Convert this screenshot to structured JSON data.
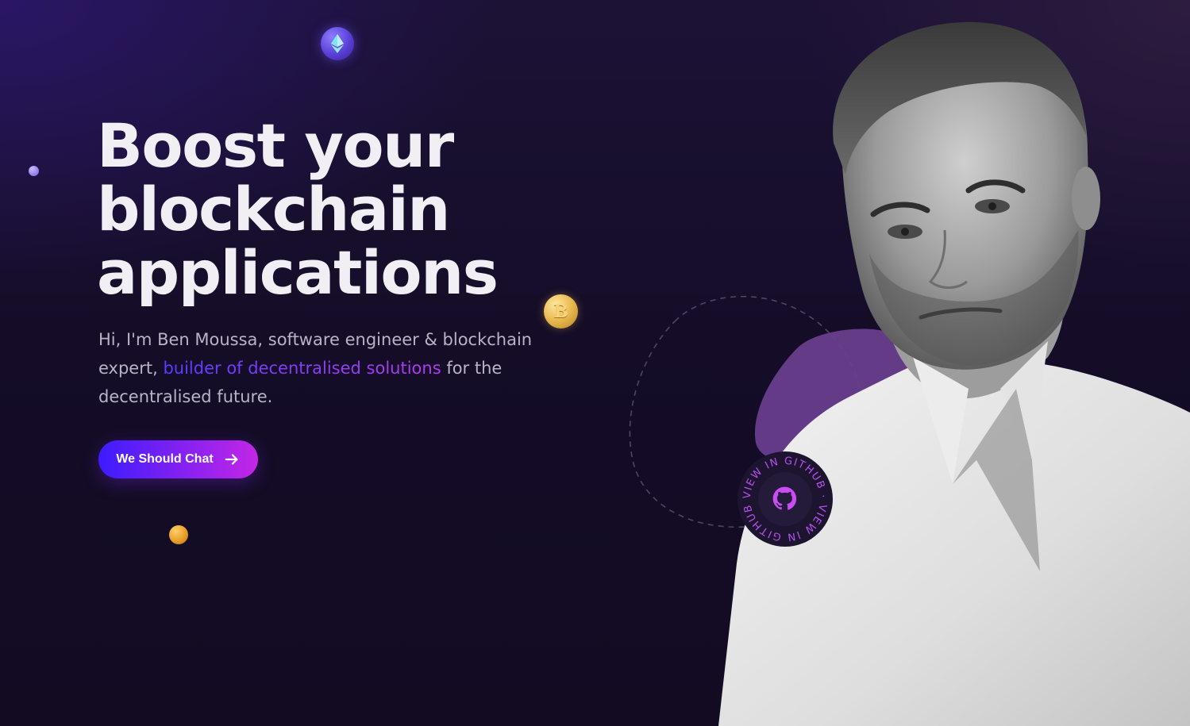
{
  "hero": {
    "headline_line1": "Boost your",
    "headline_line2": "blockchain",
    "headline_line3": "applications",
    "intro_prefix": "Hi, I'm Ben Moussa, software engineer & blockchain expert, ",
    "intro_highlight": "builder of decentralised solutions",
    "intro_suffix": " for the decentralised future.",
    "cta_label": "We Should Chat",
    "cta_icon": "arrow-right-icon"
  },
  "badge": {
    "ring_text": "VIEW IN GITHUB · VIEW IN GITHUB · ",
    "icon": "github-icon"
  },
  "decor": {
    "eth_coin_icon": "ethereum-icon",
    "btc_coin_symbol": "B"
  },
  "colors": {
    "accent_start": "#3d1cff",
    "accent_end": "#c426e6",
    "blob": "#6a3f8f",
    "background": "#150d28"
  }
}
